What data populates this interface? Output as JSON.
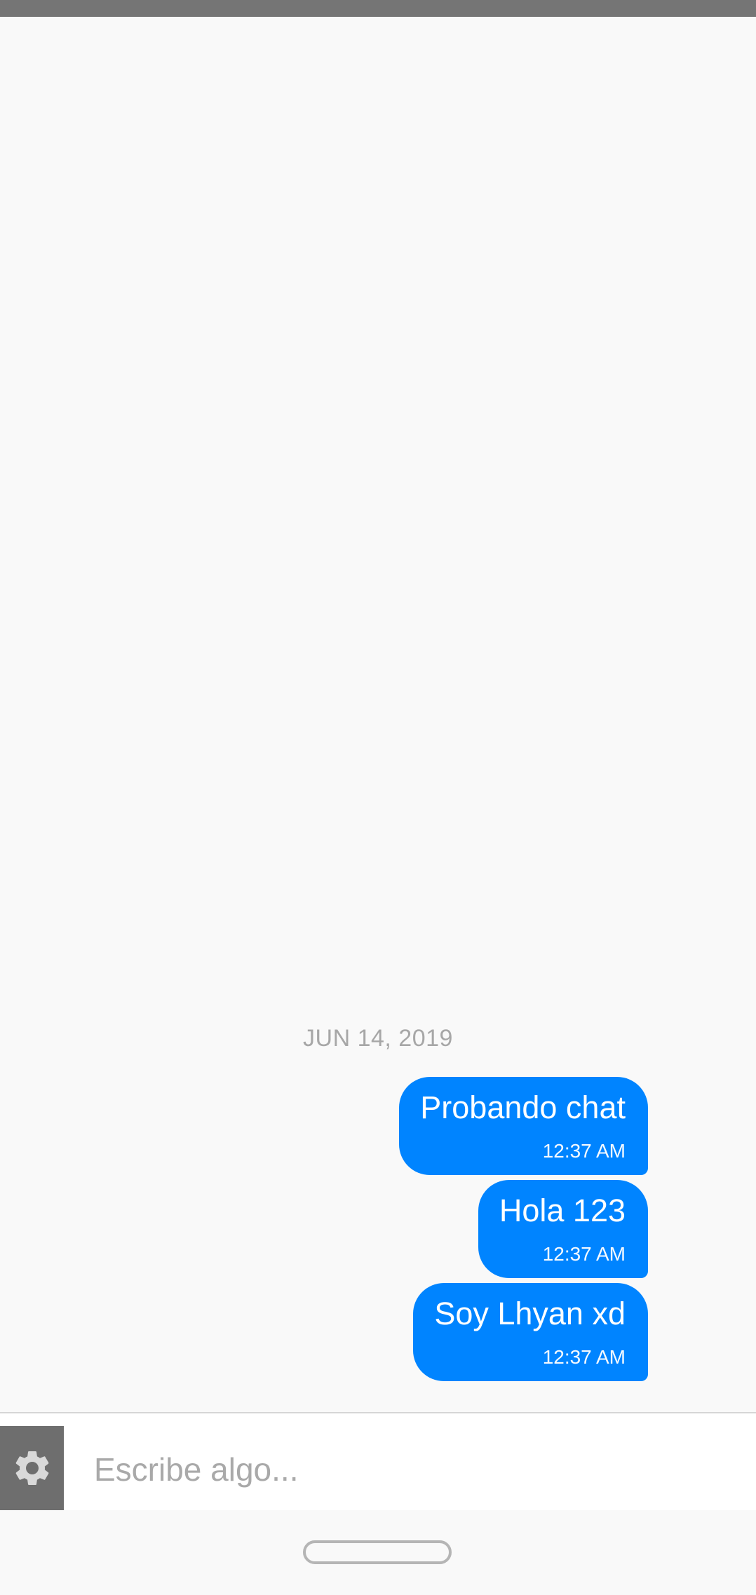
{
  "chat": {
    "date_separator": "JUN 14, 2019",
    "messages": [
      {
        "text": "Probando chat",
        "time": "12:37 AM"
      },
      {
        "text": "Hola 123",
        "time": "12:37 AM"
      },
      {
        "text": "Soy Lhyan xd",
        "time": "12:37 AM"
      }
    ]
  },
  "composer": {
    "placeholder": "Escribe algo...",
    "value": "",
    "settings_icon": "gear-icon"
  },
  "colors": {
    "bubble": "#0084ff",
    "background": "#f9f9f9",
    "settings_button": "#6e6e6e",
    "status_bar": "#757575"
  }
}
